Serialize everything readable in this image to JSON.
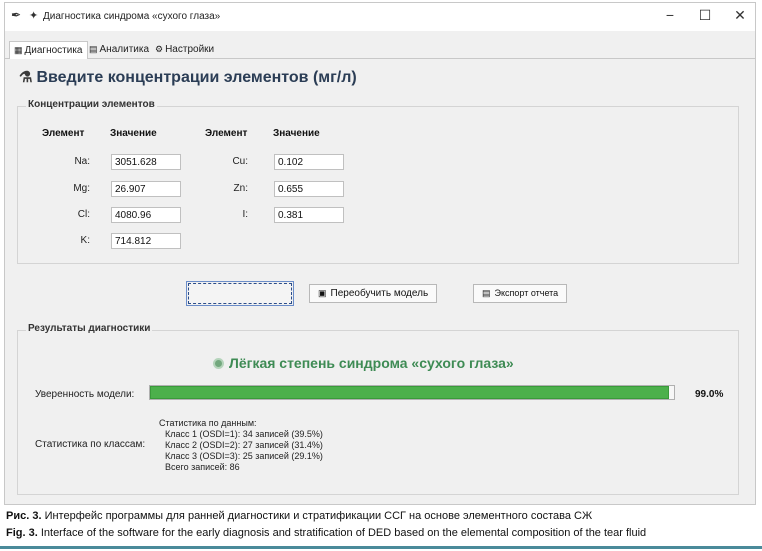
{
  "window": {
    "title": "Диагностика синдрома «сухого глаза»",
    "controls": {
      "minimize": "−",
      "maximize": "☐",
      "close": "✕"
    }
  },
  "tabs": [
    {
      "label": "Диагностика",
      "icon": "grid-icon",
      "active": true
    },
    {
      "label": "Аналитика",
      "icon": "chart-icon",
      "active": false
    },
    {
      "label": "Настройки",
      "icon": "gear-icon",
      "active": false
    }
  ],
  "heading": {
    "text": "Введите концентрации элементов (мг/л)",
    "icon": "flask-icon"
  },
  "concentrations": {
    "title": "Концентрации элементов",
    "col_element": "Элемент",
    "col_value": "Значение",
    "left": [
      {
        "label": "Na:",
        "value": "3051.628"
      },
      {
        "label": "Mg:",
        "value": "26.907"
      },
      {
        "label": "Cl:",
        "value": "4080.96"
      },
      {
        "label": "K:",
        "value": "714.812"
      }
    ],
    "right": [
      {
        "label": "Cu:",
        "value": "0.102"
      },
      {
        "label": "Zn:",
        "value": "0.655"
      },
      {
        "label": "I:",
        "value": "0.381"
      }
    ]
  },
  "actions": {
    "retrain": "Переобучить модель",
    "export": "Экспорт отчета"
  },
  "results": {
    "title": "Результаты диагностики",
    "diagnosis": "Лёгкая степень синдрома «сухого глаза»",
    "confidence_label": "Уверенность модели:",
    "confidence_value": "99.0%",
    "confidence_fraction": 0.99,
    "class_stats_label": "Статистика по классам:",
    "stats_header": "Статистика по данным:",
    "stats_lines": [
      "Класс 1 (OSDI=1): 34 записей (39.5%)",
      "Класс 2 (OSDI=2): 27 записей (31.4%)",
      "Класс 3 (OSDI=3): 25 записей (29.1%)"
    ],
    "stats_total": "Всего записей: 86"
  },
  "caption": {
    "ru_prefix": "Рис. 3.",
    "ru_text": " Интерфейс программы для ранней диагностики и стратификации ССГ на основе элементного состава СЖ",
    "en_prefix": "Fig. 3.",
    "en_text": " Interface of the software for the early diagnosis and stratification of DED based on the elemental composition of the tear fluid"
  },
  "colors": {
    "diagnosis": "#3e8b54",
    "progress": "#4cb04b",
    "heading": "#2b3d55",
    "rule": "#4a8a9a"
  }
}
